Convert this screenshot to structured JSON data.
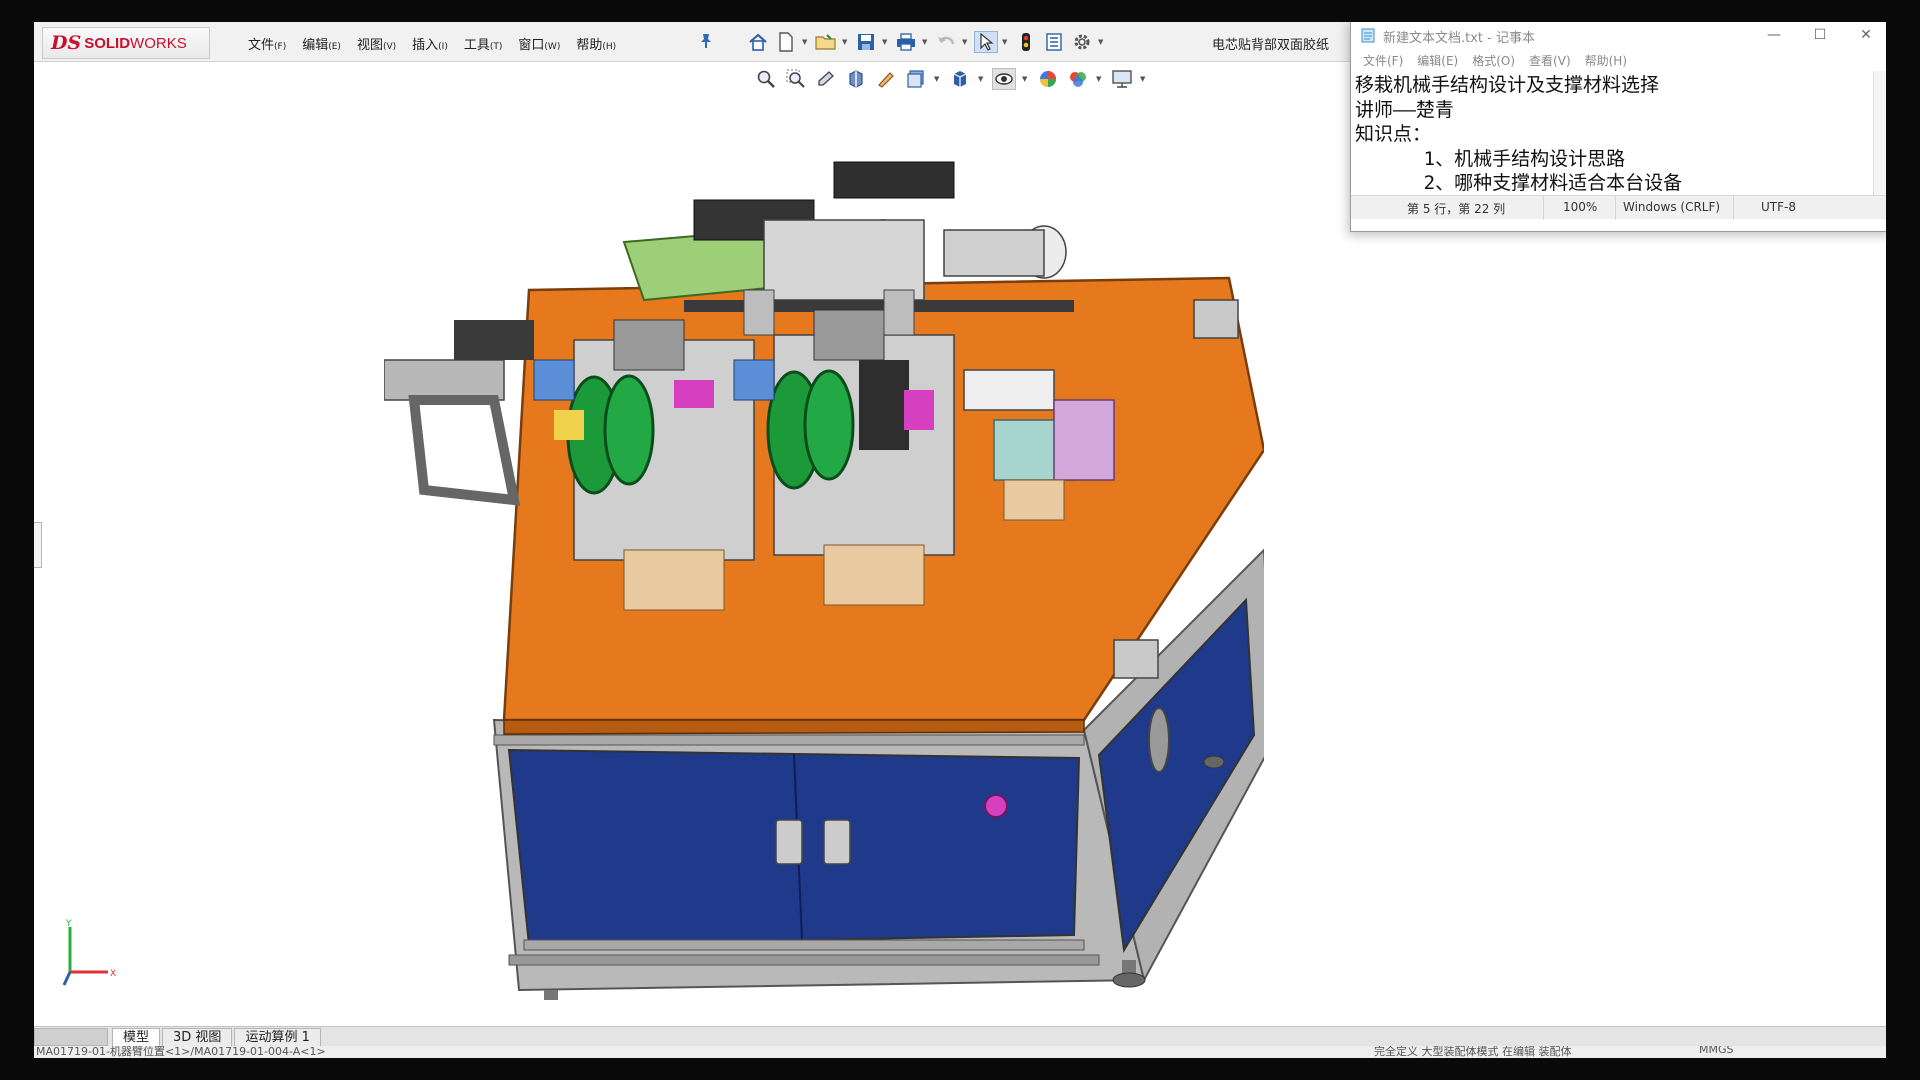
{
  "solidworks": {
    "logo_ds": "DS",
    "logo_solid": "SOLID",
    "logo_works": "WORKS",
    "menu": [
      {
        "label": "文件",
        "accel": "(F)"
      },
      {
        "label": "编辑",
        "accel": "(E)"
      },
      {
        "label": "视图",
        "accel": "(V)"
      },
      {
        "label": "插入",
        "accel": "(I)"
      },
      {
        "label": "工具",
        "accel": "(T)"
      },
      {
        "label": "窗口",
        "accel": "(W)"
      },
      {
        "label": "帮助",
        "accel": "(H)"
      }
    ],
    "document_title": "电芯贴背部双面胶纸",
    "toolbar_icons": [
      "home-icon",
      "new-document-icon",
      "open-folder-icon",
      "save-icon",
      "print-icon",
      "undo-icon",
      "select-arrow-icon",
      "rebuild-traffic-light-icon",
      "file-properties-icon",
      "options-gear-icon"
    ],
    "view_icons": [
      "zoom-to-fit-icon",
      "zoom-to-area-icon",
      "previous-view-icon",
      "section-view-icon",
      "dynamic-annotation-icon",
      "view-orientation-icon",
      "display-style-icon",
      "hide-show-items-icon",
      "edit-appearance-icon",
      "apply-scene-icon",
      "view-settings-icon"
    ],
    "bottom_tabs": [
      "模型",
      "3D 视图",
      "运动算例 1"
    ],
    "active_tab": "模型",
    "status_left": "MA01719-01-机器臂位置<1>/MA01719-01-004-A<1>",
    "status_right": "完全定义    大型装配体模式    在编辑 装配体",
    "status_units": "MMGS",
    "colors": {
      "tabletop": "#e6791e",
      "cabinet": "#1f3a8a",
      "frame": "#a9a9a9",
      "wheels": "#1c9a3a",
      "accent_magenta": "#d63fbf"
    }
  },
  "notepad": {
    "title": "新建文本文档.txt - 记事本",
    "menu": [
      "文件(F)",
      "编辑(E)",
      "格式(O)",
      "查看(V)",
      "帮助(H)"
    ],
    "lines": [
      "移栽机械手结构设计及支撑材料选择",
      "讲师——楚青",
      "知识点：",
      "      1、机械手结构设计思路",
      "      2、哪种支撑材料适合本台设备"
    ],
    "status": {
      "position": "第 5 行，第 22 列",
      "zoom": "100%",
      "line_ending": "Windows (CRLF)",
      "encoding": "UTF-8"
    }
  }
}
